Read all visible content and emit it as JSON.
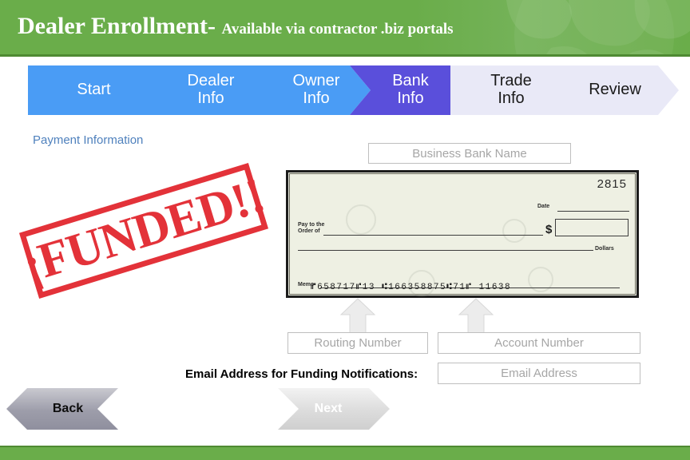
{
  "header": {
    "title_main": "Dealer Enrollment-",
    "title_sub": "Available via contractor .biz portals",
    "background_color": "#6aad4a",
    "globe_icon": "world-map-watermark-icon"
  },
  "steps": [
    {
      "label": "Start",
      "state": "done"
    },
    {
      "label_line1": "Dealer",
      "label_line2": "Info",
      "state": "done"
    },
    {
      "label_line1": "Owner",
      "label_line2": "Info",
      "state": "done"
    },
    {
      "label_line1": "Bank",
      "label_line2": "Info",
      "state": "active"
    },
    {
      "label_line1": "Trade",
      "label_line2": "Info",
      "state": "todo"
    },
    {
      "label": "Review",
      "state": "todo"
    }
  ],
  "step_colors": {
    "done": "#4a9cf5",
    "active": "#5a4fdb",
    "todo": "#e9e9f7"
  },
  "main": {
    "section_title": "Payment Information",
    "section_title_color": "#4f81bd",
    "fields": {
      "bank_name": {
        "value": "",
        "placeholder": "Business Bank Name"
      },
      "routing_number": {
        "value": "",
        "placeholder": "Routing Number"
      },
      "account_number": {
        "value": "",
        "placeholder": "Account Number"
      },
      "email_address": {
        "value": "",
        "placeholder": "Email Address"
      }
    },
    "email_label": "Email Address for Funding Notifications:",
    "arrows": {
      "routing_arrow": "up-arrow-icon",
      "account_arrow": "up-arrow-icon"
    }
  },
  "check": {
    "check_number": "2815",
    "date_label": "Date",
    "pay_to_line1": "Pay to the",
    "pay_to_line2": "Order of",
    "dollar_sign": "$",
    "dollars_label": "Dollars",
    "memo_label": "Memo",
    "micr_line": "⑈658717⑈13  ⑆166358875⑆71⑈  11638",
    "paper_color": "#eef0e3"
  },
  "stamp": {
    "text": "¡FUNDED!!",
    "color": "#e1232b"
  },
  "nav": {
    "back_label": "Back",
    "next_label": "Next"
  },
  "footer": {
    "background_color": "#6aad4a"
  }
}
